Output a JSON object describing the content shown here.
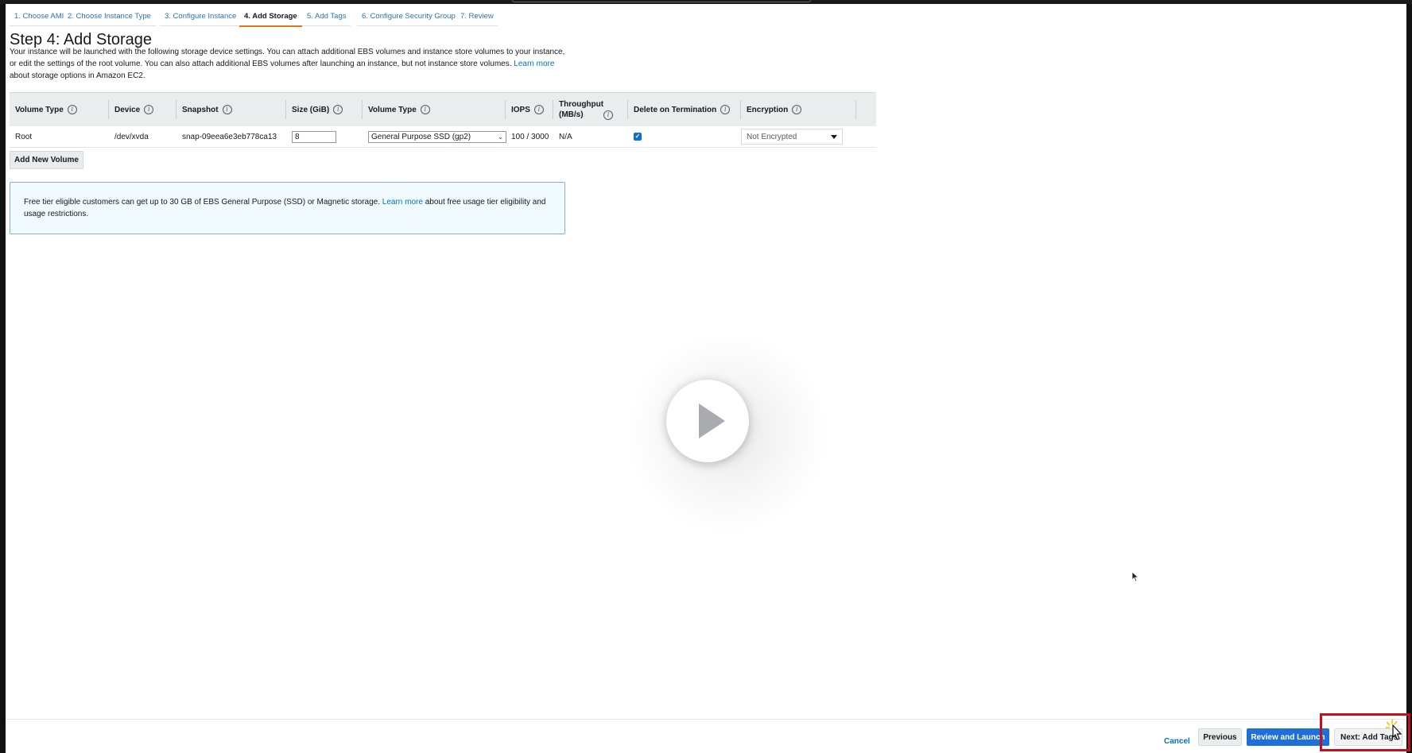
{
  "steps": [
    {
      "label": "1. Choose AMI",
      "active": false
    },
    {
      "label": "2. Choose Instance Type",
      "active": false
    },
    {
      "label": "3. Configure Instance",
      "active": false
    },
    {
      "label": "4. Add Storage",
      "active": true
    },
    {
      "label": "5. Add Tags",
      "active": false
    },
    {
      "label": "6. Configure Security Group",
      "active": false
    },
    {
      "label": "7. Review",
      "active": false
    }
  ],
  "page": {
    "title": "Step 4: Add Storage",
    "intro_text": "Your instance will be launched with the following storage device settings. You can attach additional EBS volumes and instance store volumes to your instance, or edit the settings of the root volume. You can also attach additional EBS volumes after launching an instance, but not instance store volumes.",
    "intro_link": "Learn more",
    "intro_tail": "about storage options in Amazon EC2."
  },
  "table": {
    "headers": {
      "volume_type": "Volume Type",
      "device": "Device",
      "snapshot": "Snapshot",
      "size": "Size (GiB)",
      "volume_type2": "Volume Type",
      "iops": "IOPS",
      "throughput": "Throughput (MB/s)",
      "delete": "Delete on Termination",
      "encryption": "Encryption"
    },
    "row": {
      "volume_type": "Root",
      "device": "/dev/xvda",
      "snapshot": "snap-09eea6e3eb778ca13",
      "size": "8",
      "volume_type_select": "General Purpose SSD (gp2)",
      "iops": "100 / 3000",
      "throughput": "N/A",
      "delete_on_termination": true,
      "encryption": "Not Encrypted"
    }
  },
  "add_volume_button": "Add New Volume",
  "notice": {
    "text": "Free tier eligible customers can get up to 30 GB of EBS General Purpose (SSD) or Magnetic storage.",
    "link": "Learn more",
    "tail": "about free usage tier eligibility and usage restrictions."
  },
  "footer": {
    "cancel": "Cancel",
    "previous": "Previous",
    "review_launch": "Review and Launch",
    "next": "Next: Add Tags"
  },
  "colors": {
    "link": "#0073bb",
    "active_tab_underline": "#ec7211",
    "primary_button": "#1e6fd9",
    "highlight_box": "#c0121d"
  }
}
